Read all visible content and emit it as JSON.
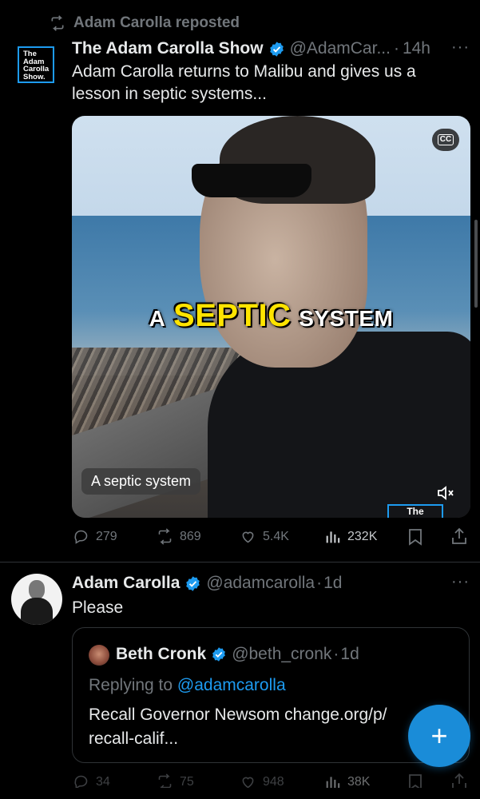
{
  "repost": {
    "label": "Adam Carolla reposted"
  },
  "post1": {
    "avatar_lines": [
      "The",
      "Adam",
      "Carolla",
      "Show."
    ],
    "author_name": "The Adam Carolla Show",
    "handle": "@AdamCar...",
    "separator": "·",
    "time": "14h",
    "more": "···",
    "text": "Adam Carolla returns to Malibu and gives us a lesson in septic systems...",
    "video": {
      "cc_label": "CC",
      "caption_a": "A",
      "caption_highlight": "SEPTIC",
      "caption_b": "SYSTEM",
      "subtitle": "A septic system",
      "endcard": "The"
    },
    "actions": {
      "replies": "279",
      "reposts": "869",
      "likes": "5.4K",
      "views": "232K"
    }
  },
  "post2": {
    "author_name": "Adam Carolla",
    "handle": "@adamcarolla",
    "separator": "·",
    "time": "1d",
    "more": "···",
    "text": "Please",
    "quote": {
      "author_name": "Beth Cronk",
      "handle": "@beth_cronk",
      "separator": "·",
      "time": "1d",
      "replying_prefix": "Replying to",
      "replying_to": "@adamcarolla",
      "text": "Recall Governor Newsom change.org/p/ recall-calif..."
    },
    "actions": {
      "replies": "34",
      "reposts": "75",
      "likes": "948",
      "views": "38K"
    }
  },
  "fab": {
    "label": "+"
  },
  "colors": {
    "accent": "#1d9bf0",
    "muted": "#71767b",
    "background": "#000000"
  }
}
